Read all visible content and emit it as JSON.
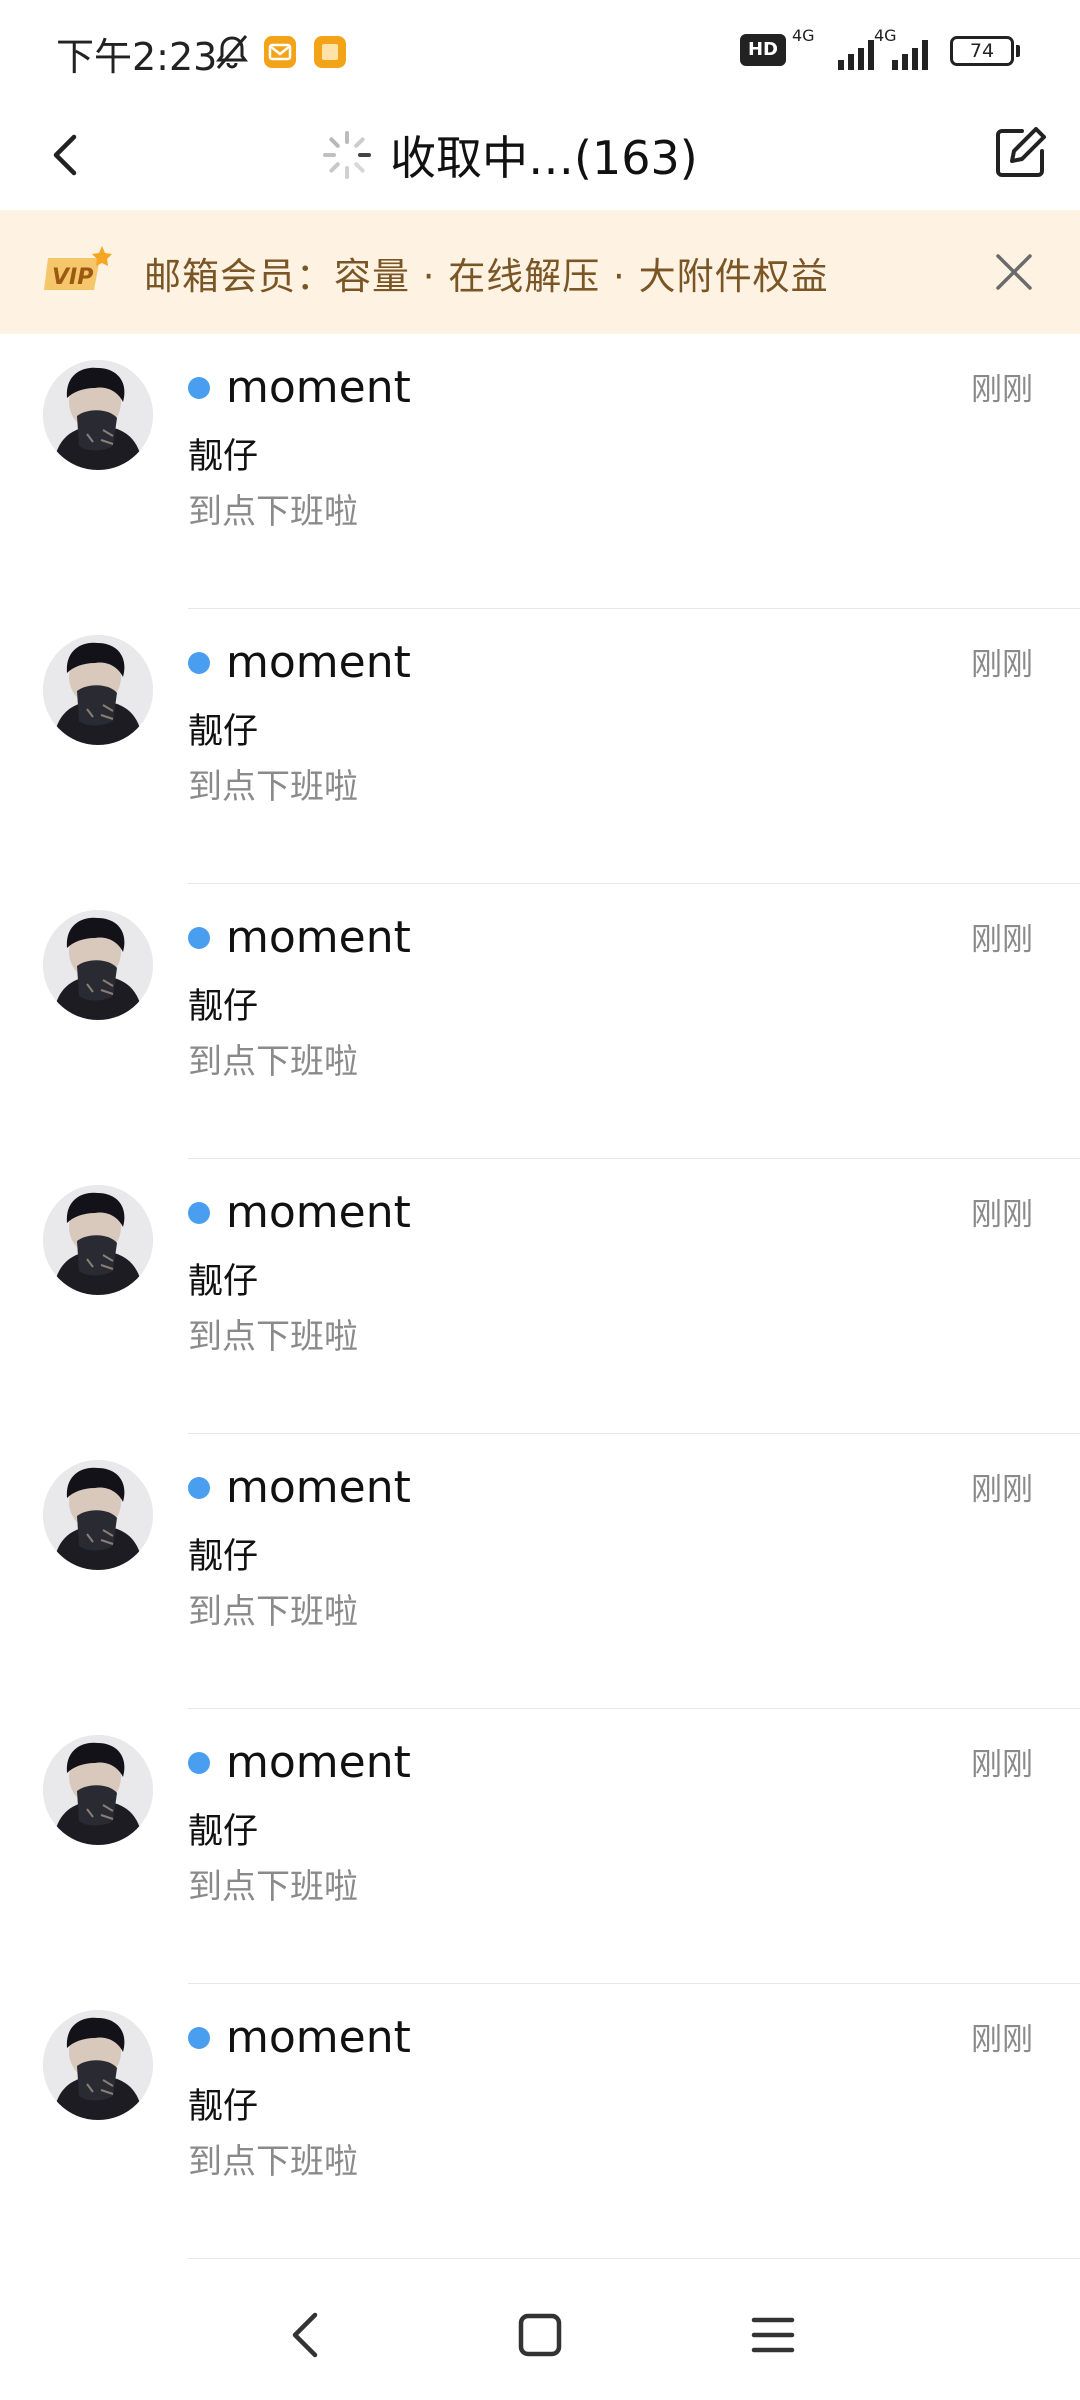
{
  "status_bar": {
    "time": "下午2:23",
    "network_1": "4G",
    "network_2": "4G",
    "hd_label": "HD",
    "battery": "74"
  },
  "header": {
    "title": "收取中…(163)",
    "icons": {
      "back": "chevron-left-icon",
      "loading": "spinner-icon",
      "compose": "compose-icon"
    }
  },
  "banner": {
    "badge": "VIP",
    "text": "邮箱会员：容量 · 在线解压 · 大附件权益",
    "close_icon": "close-icon",
    "background": "#fef3e2",
    "text_color": "#7a5626"
  },
  "mails": [
    {
      "sender": "moment",
      "time": "刚刚",
      "subject": "靓仔",
      "preview": "到点下班啦",
      "unread": true
    },
    {
      "sender": "moment",
      "time": "刚刚",
      "subject": "靓仔",
      "preview": "到点下班啦",
      "unread": true
    },
    {
      "sender": "moment",
      "time": "刚刚",
      "subject": "靓仔",
      "preview": "到点下班啦",
      "unread": true
    },
    {
      "sender": "moment",
      "time": "刚刚",
      "subject": "靓仔",
      "preview": "到点下班啦",
      "unread": true
    },
    {
      "sender": "moment",
      "time": "刚刚",
      "subject": "靓仔",
      "preview": "到点下班啦",
      "unread": true
    },
    {
      "sender": "moment",
      "time": "刚刚",
      "subject": "靓仔",
      "preview": "到点下班啦",
      "unread": true
    },
    {
      "sender": "moment",
      "time": "刚刚",
      "subject": "靓仔",
      "preview": "到点下班啦",
      "unread": true
    }
  ],
  "colors": {
    "unread_dot": "#4a9ef0",
    "secondary_text": "#8a8a8a",
    "divider": "#e8e8e8"
  },
  "nav_bar": {
    "icons": [
      "nav-back-icon",
      "home-icon",
      "menu-icon"
    ]
  }
}
